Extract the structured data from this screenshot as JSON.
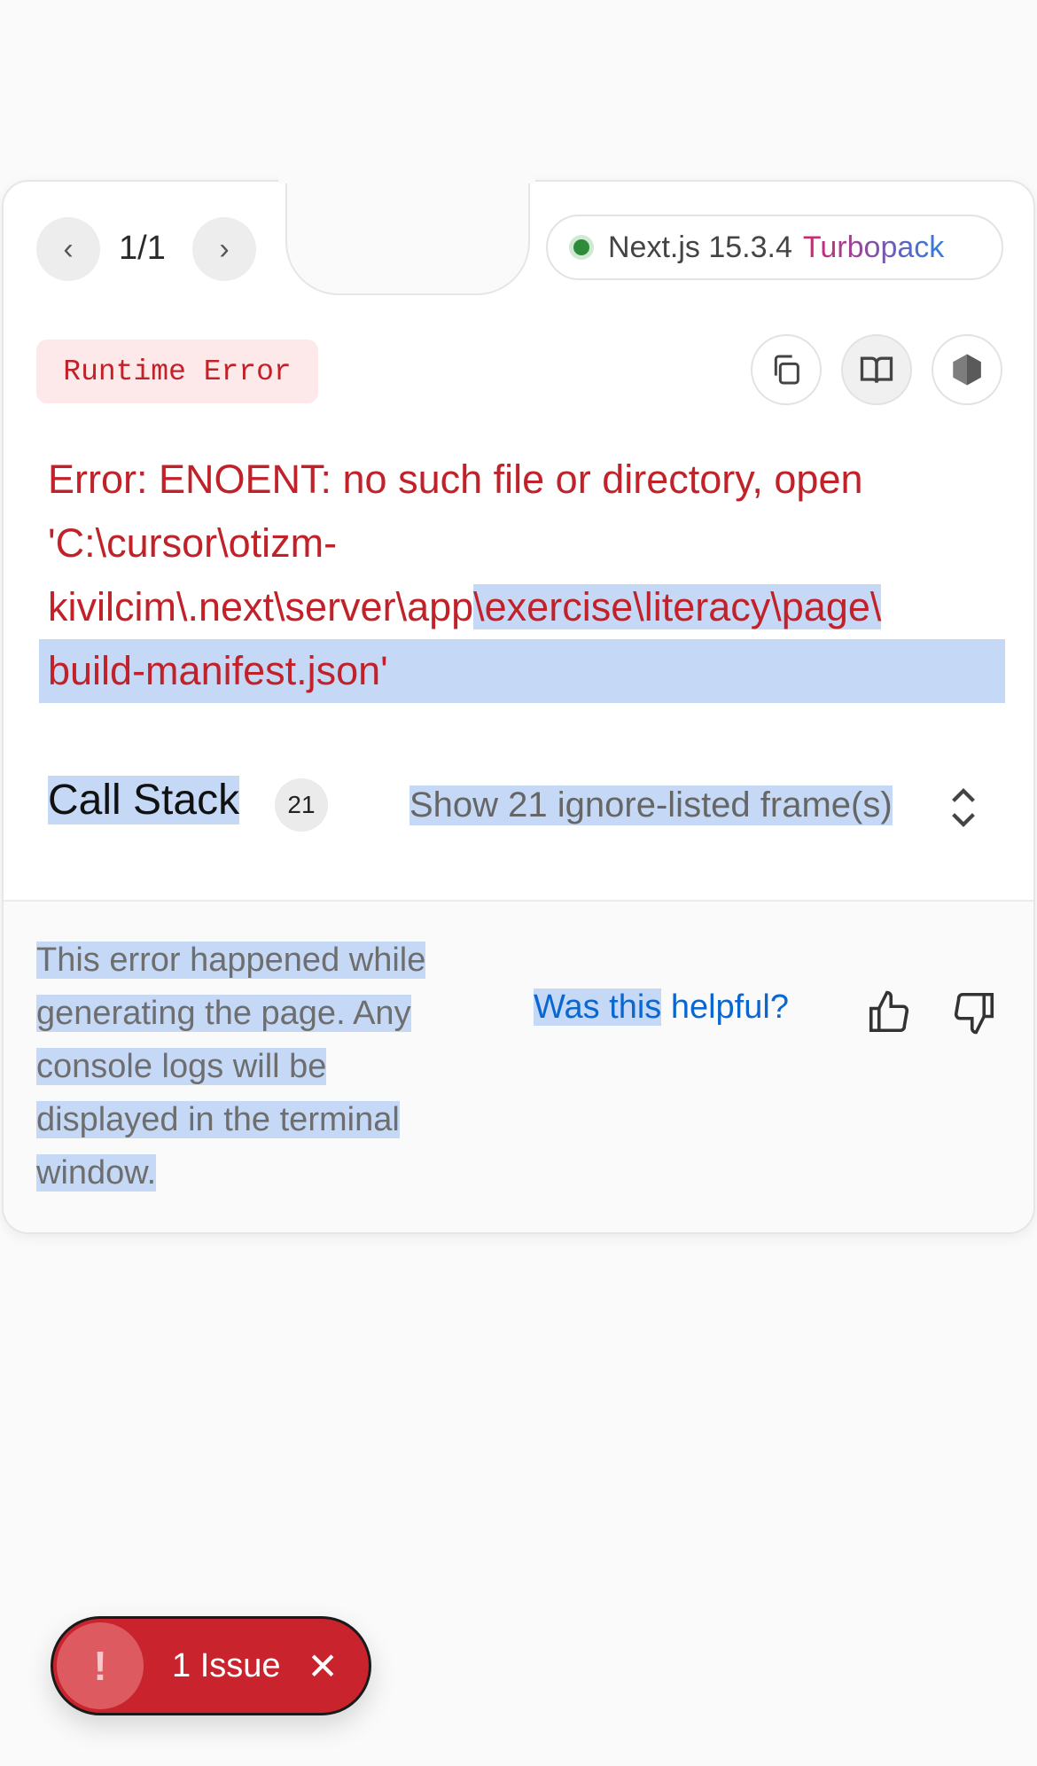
{
  "pager": {
    "count": "1/1"
  },
  "version": {
    "framework": "Next.js 15.3.4",
    "bundler": "Turbopack"
  },
  "error": {
    "badge": "Runtime Error",
    "line1": "Error: ENOENT: no such file or directory, open",
    "line2": "'C:\\cursor\\otizm-",
    "line3a": "kivilcim\\.next\\server\\app",
    "line3b": "\\exercise\\literacy\\page\\",
    "line4": "build-manifest.json'"
  },
  "call_stack": {
    "title": "Call Stack",
    "count": "21",
    "toggle_label": "Show 21 ignore-listed frame(s)"
  },
  "footer": {
    "lines": [
      "This error happened while",
      "generating the page. Any",
      "console logs will be",
      "displayed in the terminal",
      "window."
    ],
    "helpful_a": "Was this",
    "helpful_b": " helpful?"
  },
  "issue": {
    "label": "1 Issue",
    "icon": "!"
  },
  "colors": {
    "error_red": "#c1222a",
    "link_blue": "#0b67d0",
    "selection": "#c5d9f6"
  }
}
